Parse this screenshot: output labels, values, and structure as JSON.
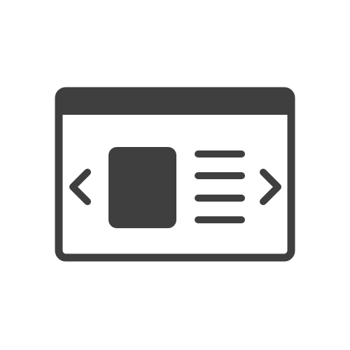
{
  "icon": {
    "name": "browser-window-carousel-icon",
    "color": "#3f3f3f",
    "background": "#ffffff",
    "parts": [
      "window-frame-icon",
      "title-bar",
      "chevron-left-icon",
      "image-placeholder-icon",
      "text-lines-icon",
      "chevron-right-icon"
    ],
    "text_line_count": 4
  }
}
